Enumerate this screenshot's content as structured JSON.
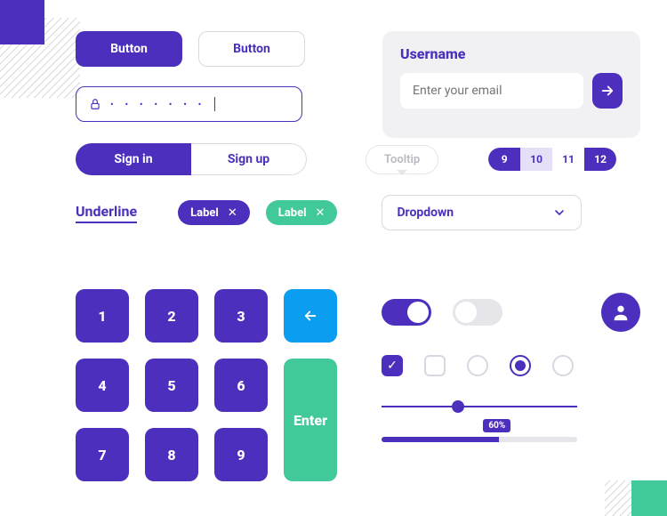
{
  "buttons": {
    "primary": "Button",
    "outline": "Button"
  },
  "password": {
    "mask": "• • • • • • •"
  },
  "card": {
    "title": "Username",
    "placeholder": "Enter your email"
  },
  "segment": {
    "left": "Sign in",
    "right": "Sign up"
  },
  "tooltip": "Tooltip",
  "pager": [
    "9",
    "10",
    "11",
    "12"
  ],
  "underline": "Underline",
  "chips": {
    "a": "Label",
    "b": "Label"
  },
  "dropdown": "Dropdown",
  "keypad": {
    "k1": "1",
    "k2": "2",
    "k3": "3",
    "k4": "4",
    "k5": "5",
    "k6": "6",
    "k7": "7",
    "k8": "8",
    "k9": "9",
    "enter": "Enter"
  },
  "progress": {
    "label": "60%",
    "value": 60
  },
  "colors": {
    "primary": "#4c2fbc",
    "accent": "#42c99a",
    "blue": "#0a9df0"
  }
}
